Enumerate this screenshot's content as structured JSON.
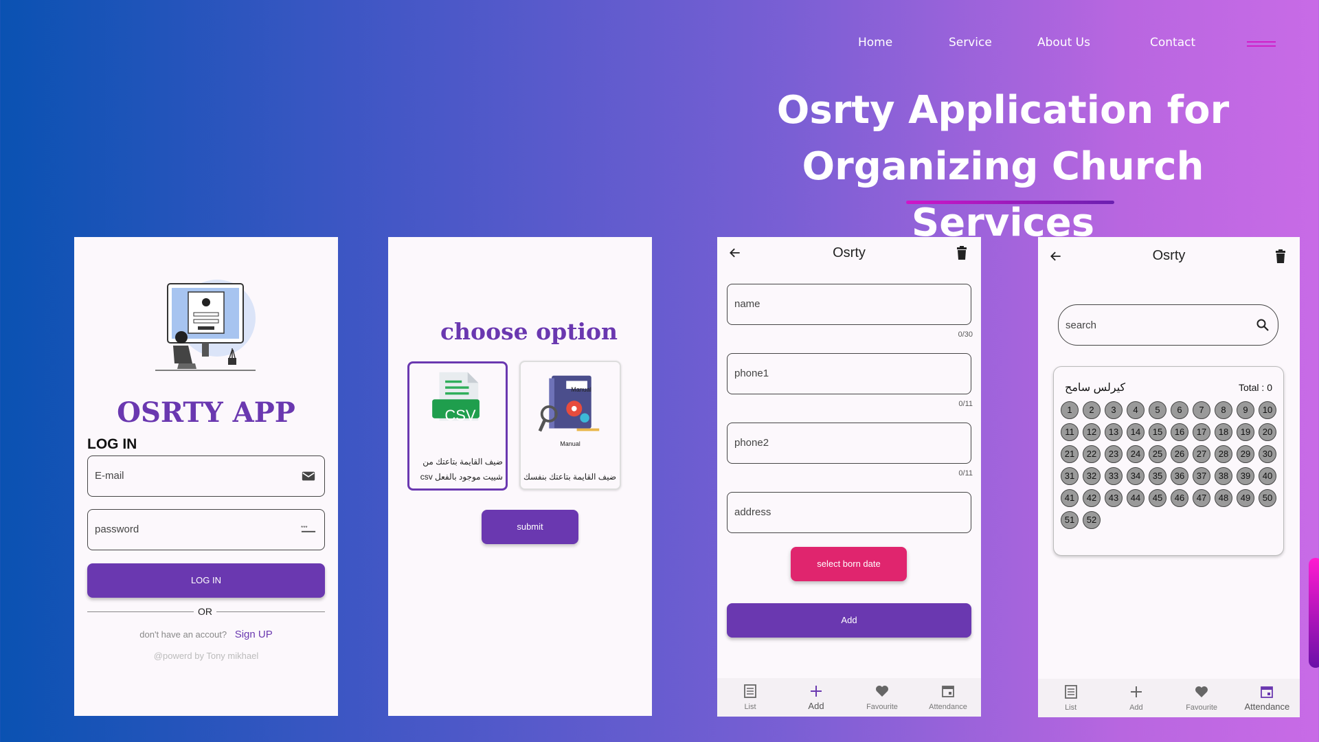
{
  "nav": {
    "home": "Home",
    "service": "Service",
    "about": "About Us",
    "contact": "Contact",
    "menu_icon": "hamburger-icon"
  },
  "hero": {
    "line1": "Osrty Application for",
    "line2": "Organizing Church Services"
  },
  "colors": {
    "accent": "#6a38b0",
    "pink": "#e0256e",
    "underline": "#d016c8"
  },
  "login_screen": {
    "brand": "OSRTY APP",
    "title": "LOG IN",
    "email_label": "E-mail",
    "password_label": "password",
    "login_button": "LOG IN",
    "or": "OR",
    "no_account": "don't have an accout?",
    "sign_up": "Sign UP",
    "powered": "@powerd by Tony mikhael"
  },
  "option_screen": {
    "title": "choose option",
    "csv_badge": "CSV",
    "csv_text": "ضيف القايمة بتاعتك من شييت موجود بالفعل csv",
    "manual_book": "Manual",
    "manual_label": "Manual",
    "manual_text": "ضيف القايمة بتاعتك بنفسك",
    "submit": "submit"
  },
  "add_screen": {
    "title": "Osrty",
    "fields": [
      {
        "label": "name",
        "counter": "0/30"
      },
      {
        "label": "phone1",
        "counter": "0/11"
      },
      {
        "label": "phone2",
        "counter": "0/11"
      },
      {
        "label": "address",
        "counter": ""
      }
    ],
    "date_button": "select born date",
    "add_button": "Add"
  },
  "attendance_screen": {
    "title": "Osrty",
    "search": "search",
    "person_name": "كيرلس سامح",
    "total": "Total :  0",
    "numbers": [
      "1",
      "2",
      "3",
      "4",
      "5",
      "6",
      "7",
      "8",
      "9",
      "10",
      "11",
      "12",
      "13",
      "14",
      "15",
      "16",
      "17",
      "18",
      "19",
      "20",
      "21",
      "22",
      "23",
      "24",
      "25",
      "26",
      "27",
      "28",
      "29",
      "30",
      "31",
      "32",
      "33",
      "34",
      "35",
      "36",
      "37",
      "38",
      "39",
      "40",
      "41",
      "42",
      "43",
      "44",
      "45",
      "46",
      "47",
      "48",
      "49",
      "50",
      "51",
      "52"
    ]
  },
  "bottom_nav": {
    "list": "List",
    "add": "Add",
    "favourite": "Favourite",
    "attendance": "Attendance"
  }
}
